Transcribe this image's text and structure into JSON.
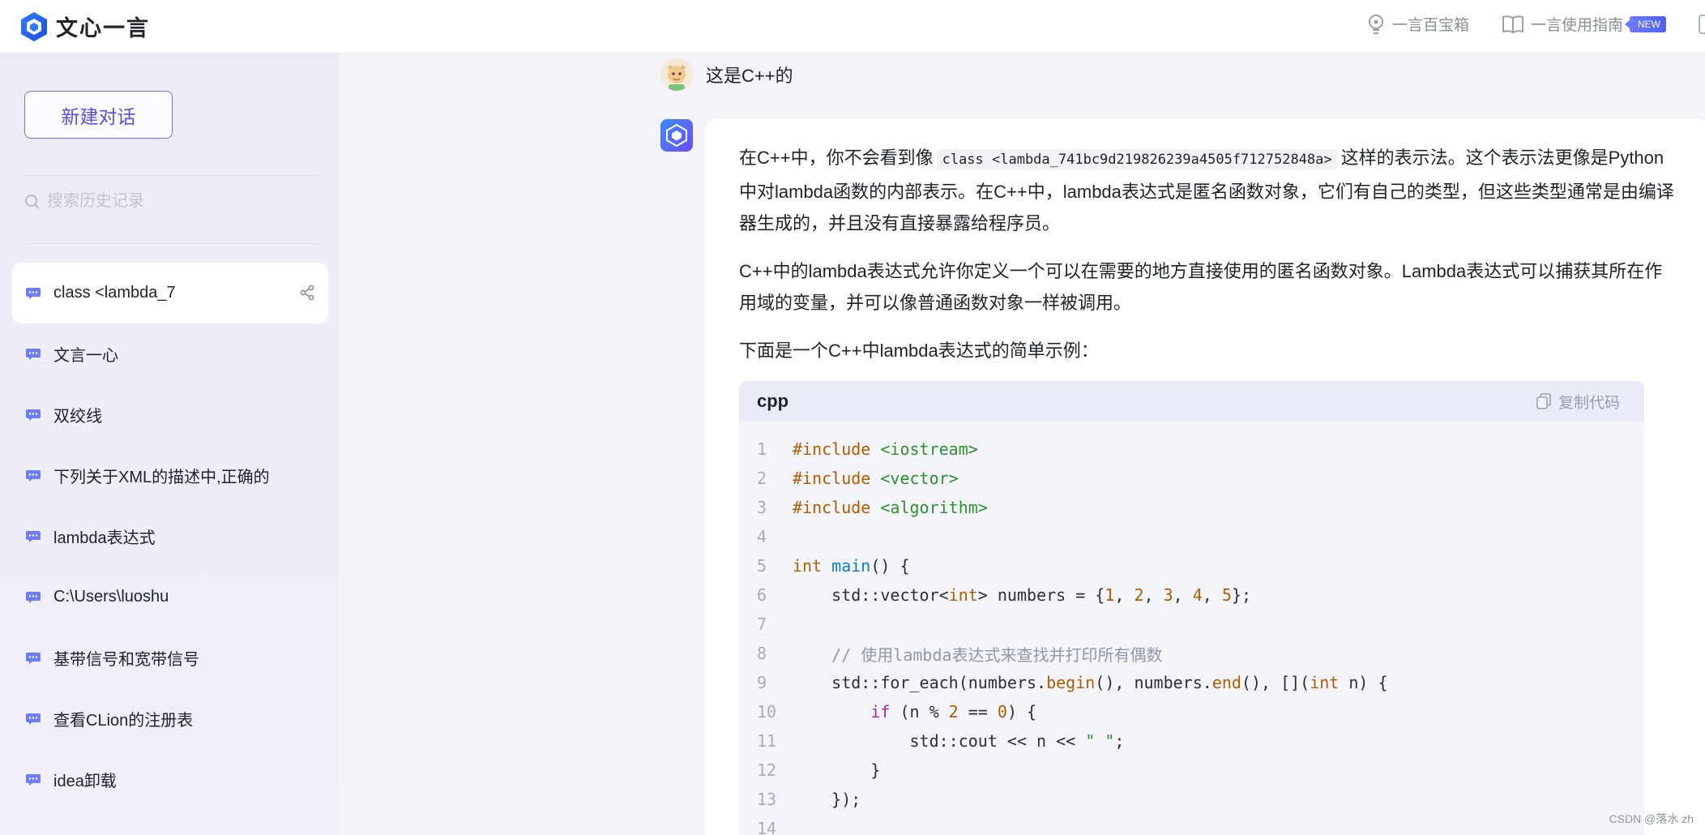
{
  "app": {
    "title": "文心一言"
  },
  "topbar": {
    "links": [
      {
        "label": "一言百宝箱",
        "icon": "lightbulb-icon"
      },
      {
        "label": "一言使用指南",
        "icon": "book-icon",
        "badge": "NEW"
      }
    ]
  },
  "sidebar": {
    "new_chat_label": "新建对话",
    "search_placeholder": "搜索历史记录",
    "history": [
      {
        "label": "class <lambda_7",
        "active": true
      },
      {
        "label": "文言一心"
      },
      {
        "label": "双绞线"
      },
      {
        "label": "下列关于XML的描述中,正确的"
      },
      {
        "label": "lambda表达式"
      },
      {
        "label": "C:\\Users\\luoshu"
      },
      {
        "label": "基带信号和宽带信号"
      },
      {
        "label": "查看CLion的注册表"
      },
      {
        "label": "idea卸载"
      }
    ]
  },
  "conversation": {
    "user_message": "这是C++的",
    "answer": {
      "p1_before": "在C++中，你不会看到像",
      "p1_code": "class <lambda_741bc9d219826239a4505f712752848a>",
      "p1_after": "这样的表示法。这个表示法更像是Python中对lambda函数的内部表示。在C++中，lambda表达式是匿名函数对象，它们有自己的类型，但这些类型通常是由编译器生成的，并且没有直接暴露给程序员。",
      "p2": "C++中的lambda表达式允许你定义一个可以在需要的地方直接使用的匿名函数对象。Lambda表达式可以捕获其所在作用域的变量，并可以像普通函数对象一样被调用。",
      "p3": "下面是一个C++中lambda表达式的简单示例：",
      "code": {
        "language": "cpp",
        "copy_label": "复制代码",
        "line_numbers": [
          "1",
          "2",
          "3",
          "4",
          "5",
          "6",
          "7",
          "8",
          "9",
          "10",
          "11",
          "12",
          "13",
          "14"
        ],
        "lines": [
          "#include <iostream>",
          "#include <vector>",
          "#include <algorithm>",
          "",
          "int main() {",
          "    std::vector<int> numbers = {1, 2, 3, 4, 5};",
          "",
          "    // 使用lambda表达式来查找并打印所有偶数",
          "    std::for_each(numbers.begin(), numbers.end(), [](int n) {",
          "        if (n % 2 == 0) {",
          "            std::cout << n << \" \";",
          "        }",
          "    });",
          ""
        ]
      }
    }
  },
  "watermark": "CSDN @落水 zh",
  "colors": {
    "accent": "#5b4de2",
    "brand_blue": "#3f8cff"
  }
}
